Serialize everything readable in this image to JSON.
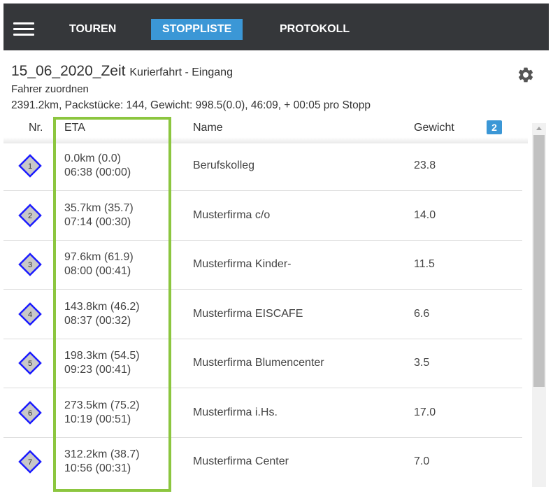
{
  "nav": {
    "tabs": [
      {
        "label": "TOUREN",
        "active": false
      },
      {
        "label": "STOPPLISTE",
        "active": true
      },
      {
        "label": "PROTOKOLL",
        "active": false
      }
    ]
  },
  "tour": {
    "title": "15_06_2020_Zeit",
    "subtitle": "Kurierfahrt - Eingang",
    "assign_driver": "Fahrer zuordnen",
    "summary": "2391.2km, Packstücke: 144, Gewicht: 998.5(0.0), 46:09, + 00:05 pro Stopp"
  },
  "table": {
    "headers": {
      "nr": "Nr.",
      "eta": "ETA",
      "name": "Name",
      "weight": "Gewicht"
    },
    "badge": "2",
    "rows": [
      {
        "nr": "1",
        "eta_km": "0.0km (0.0)",
        "eta_time": "06:38 (00:00)",
        "name": "Berufskolleg",
        "weight": "23.8"
      },
      {
        "nr": "2",
        "eta_km": "35.7km (35.7)",
        "eta_time": "07:14 (00:30)",
        "name": "Musterfirma c/o",
        "weight": "14.0"
      },
      {
        "nr": "3",
        "eta_km": "97.6km (61.9)",
        "eta_time": "08:00 (00:41)",
        "name": "Musterfirma Kinder-",
        "weight": "11.5"
      },
      {
        "nr": "4",
        "eta_km": "143.8km (46.2)",
        "eta_time": "08:37 (00:32)",
        "name": "Musterfirma EISCAFE",
        "weight": "6.6"
      },
      {
        "nr": "5",
        "eta_km": "198.3km (54.5)",
        "eta_time": "09:23 (00:41)",
        "name": "Musterfirma Blumencenter",
        "weight": "3.5"
      },
      {
        "nr": "6",
        "eta_km": "273.5km (75.2)",
        "eta_time": "10:19 (00:51)",
        "name": "Musterfirma i.Hs.",
        "weight": "17.0"
      },
      {
        "nr": "7",
        "eta_km": "312.2km (38.7)",
        "eta_time": "10:56 (00:31)",
        "name": "Musterfirma Center",
        "weight": "7.0"
      }
    ]
  },
  "colors": {
    "topbar": "#35373a",
    "accent": "#3b97d6",
    "highlight": "#8cc63f",
    "marker_fill": "#c8c8c8",
    "marker_stroke": "#1a1aff"
  },
  "icons": {
    "menu": "hamburger-icon",
    "settings": "gear-icon",
    "stop_marker": "diamond-marker-icon",
    "scroll_up": "scroll-up-arrow-icon"
  }
}
